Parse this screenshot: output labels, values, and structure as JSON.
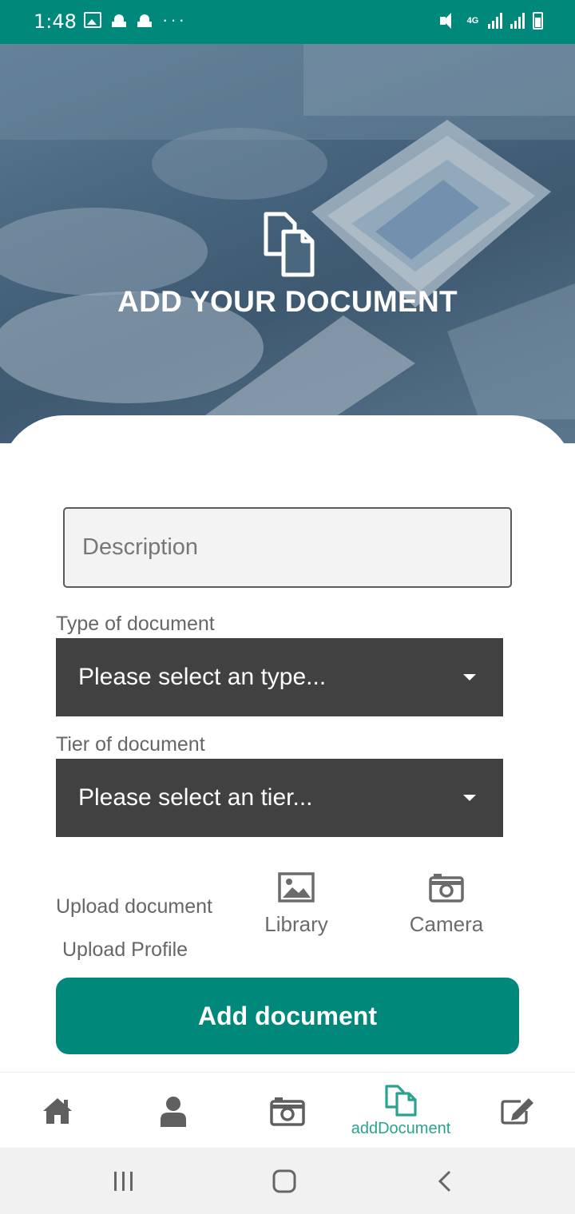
{
  "status_bar": {
    "time": "1:48",
    "network_label": "4G",
    "left_icons": [
      "gallery-icon",
      "mosque-icon",
      "mosque-icon",
      "more-dots-icon"
    ],
    "right_icons": [
      "mute-icon",
      "network-4g-icon",
      "signal-icon",
      "signal-icon",
      "battery-charging-icon"
    ],
    "dots": "···"
  },
  "hero": {
    "title": "ADD YOUR DOCUMENT",
    "icon": "documents-icon"
  },
  "form": {
    "description": {
      "placeholder": "Description",
      "value": ""
    },
    "type": {
      "label": "Type of document",
      "selected": "Please select an type..."
    },
    "tier": {
      "label": "Tier of document",
      "selected": "Please select an tier..."
    },
    "upload": {
      "document_label": "Upload document",
      "profile_label": "Upload Profile",
      "library_label": "Library",
      "camera_label": "Camera"
    },
    "submit_label": "Add document"
  },
  "bottom_nav": {
    "items": [
      {
        "icon": "home-icon",
        "label": ""
      },
      {
        "icon": "person-icon",
        "label": ""
      },
      {
        "icon": "camera-icon",
        "label": ""
      },
      {
        "icon": "documents-icon",
        "label": "addDocument",
        "active": true
      },
      {
        "icon": "edit-icon",
        "label": ""
      }
    ]
  },
  "colors": {
    "primary": "#00897b",
    "active_nav": "#2aa28f",
    "select_bg": "#414141"
  }
}
